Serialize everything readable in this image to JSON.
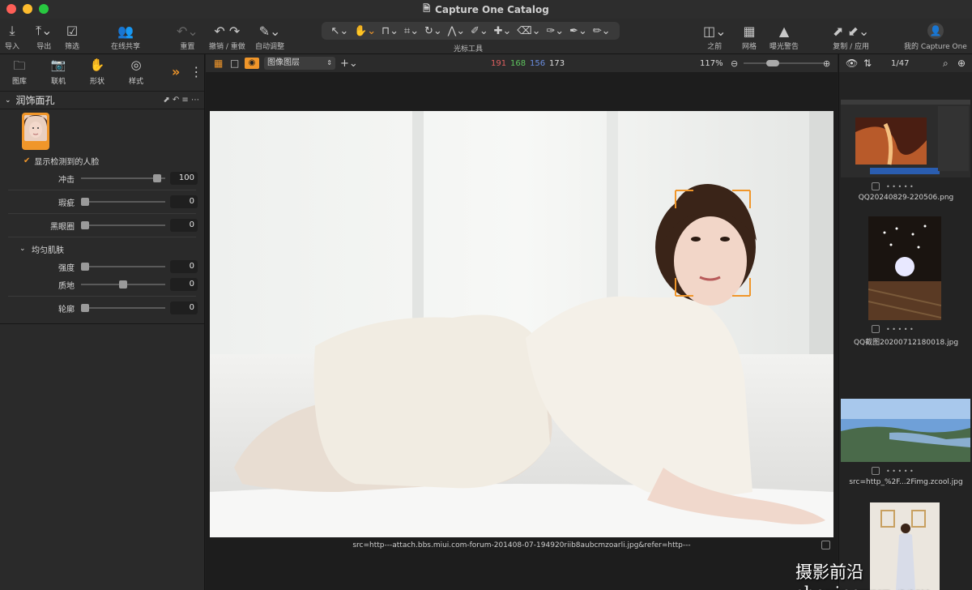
{
  "window": {
    "title": "Capture One Catalog"
  },
  "toolbar": {
    "import": "导入",
    "export": "导出",
    "filter": "筛选",
    "share": "在线共享",
    "reset": "重置",
    "undo_redo": "撤销 / 重做",
    "auto_adjust": "自动调整",
    "cursor_tools": "光标工具",
    "before": "之前",
    "grid": "网格",
    "exposure_warning": "曝光警告",
    "copy_apply": "复制 / 应用",
    "account": "我的 Capture One"
  },
  "left_panel": {
    "tabs": [
      {
        "label": "图库",
        "icon": "folder-icon"
      },
      {
        "label": "联机",
        "icon": "camera-icon"
      },
      {
        "label": "形状",
        "icon": "hand-icon"
      },
      {
        "label": "样式",
        "icon": "style-icon"
      }
    ],
    "section_title": "润饰面孔",
    "show_faces_label": "显示检测到的人脸",
    "sliders": [
      {
        "label": "冲击",
        "value": "100",
        "level": 0.95
      },
      {
        "label": "瑕疵",
        "value": "0",
        "level": 0
      },
      {
        "label": "黑眼圈",
        "value": "0",
        "level": 0
      }
    ],
    "subsection_title": "均匀肌肤",
    "sub_sliders": [
      {
        "label": "强度",
        "value": "0",
        "level": 0
      },
      {
        "label": "质地",
        "value": "0",
        "level": 0.5
      }
    ],
    "contour": {
      "label": "轮廓",
      "value": "0",
      "level": 0
    }
  },
  "viewer": {
    "layer_select": "图像图层",
    "rgb": {
      "r": "191",
      "g": "168",
      "b": "156",
      "l": "173"
    },
    "zoom": "117%",
    "caption": "src=http---attach.bbs.miui.com-forum-201408-07-194920riib8aubcmzoarli.jpg&refer=http---"
  },
  "browser": {
    "count": "1/47",
    "items": [
      {
        "name": "QQ20240829-220506.png"
      },
      {
        "name": "QQ截图20200712180018.jpg"
      },
      {
        "name": "src=http_%2F...2Fimg.zcool.jpg"
      }
    ]
  },
  "watermark": "摄影前沿 sheyingzyz.com",
  "colors": {
    "accent": "#f0962a",
    "red": "#e06060",
    "green": "#5ec45e",
    "blue": "#6a8ee0"
  }
}
